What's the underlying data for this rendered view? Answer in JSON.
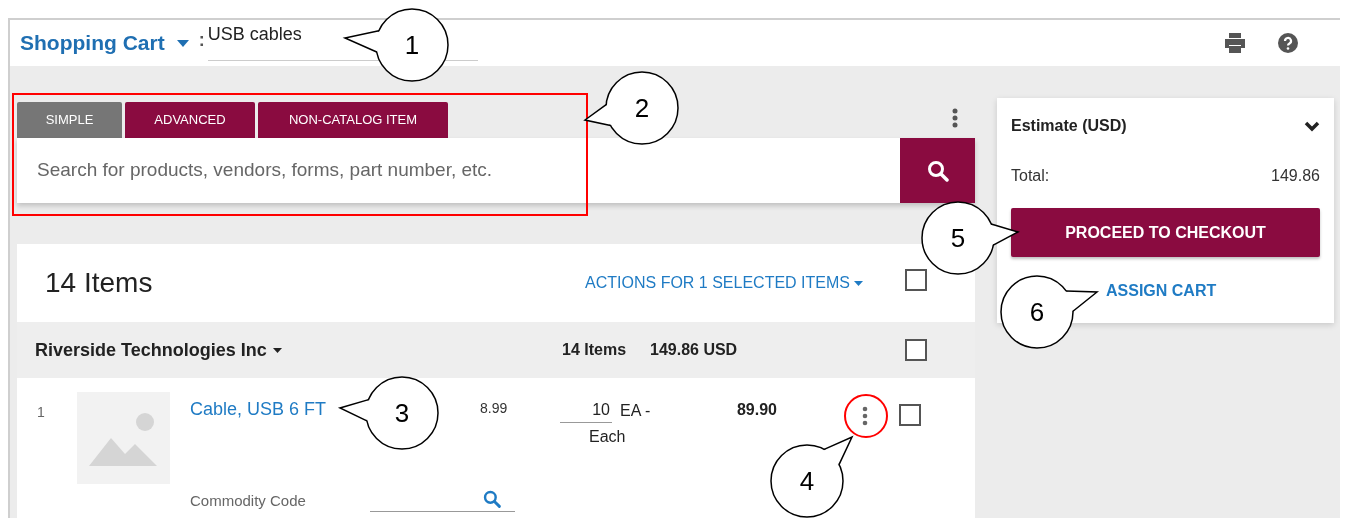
{
  "header": {
    "title": "Shopping Cart",
    "separator": ":",
    "cart_name": "USB cables"
  },
  "search": {
    "tabs": [
      {
        "label": "SIMPLE",
        "selected": true
      },
      {
        "label": "ADVANCED",
        "selected": false
      },
      {
        "label": "NON-CATALOG ITEM",
        "selected": false
      }
    ],
    "placeholder": "Search for products, vendors, forms, part number, etc."
  },
  "cart": {
    "count": "14 Items",
    "actions": "ACTIONS FOR 1 SELECTED ITEMS",
    "checked": false
  },
  "supplier": {
    "name": "Riverside Technologies Inc",
    "items": "14 Items",
    "total": "149.86 USD",
    "checked": false
  },
  "lines": [
    {
      "number": "1",
      "name": "Cable, USB 6 FT",
      "price": "8.99",
      "quantity": "10",
      "unit_code": "EA -",
      "unit_name": "Each",
      "total": "89.90",
      "checked": false,
      "commodity_label": "Commodity Code"
    }
  ],
  "summary": {
    "title": "Estimate (USD)",
    "total_label": "Total:",
    "total": "149.86",
    "checkout": "PROCEED TO CHECKOUT",
    "assign": "ASSIGN CART"
  },
  "callouts": [
    "1",
    "2",
    "3",
    "4",
    "5",
    "6"
  ],
  "highlights": [
    {
      "kind": "frame"
    },
    {
      "kind": "ring"
    }
  ]
}
